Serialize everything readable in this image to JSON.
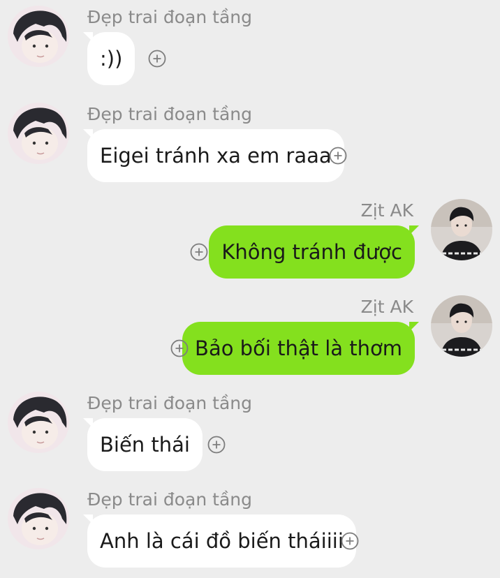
{
  "messages": [
    {
      "side": "left",
      "sender": "Đẹp trai đoạn tầng",
      "text": ":))"
    },
    {
      "side": "left",
      "sender": "Đẹp trai đoạn tầng",
      "text": "Eigei tránh xa em raaa"
    },
    {
      "side": "right",
      "sender": "Zịt AK",
      "text": "Không tránh được"
    },
    {
      "side": "right",
      "sender": "Zịt AK",
      "text": "Bảo bối thật là thơm"
    },
    {
      "side": "left",
      "sender": "Đẹp trai đoạn tầng",
      "text": "Biến thái"
    },
    {
      "side": "left",
      "sender": "Đẹp trai đoạn tầng",
      "text": "Anh là cái đồ biến tháiiii"
    }
  ],
  "colors": {
    "background": "#ededed",
    "outgoing_bubble": "#84e01e",
    "incoming_bubble": "#ffffff",
    "sender_text": "#8a8a8a"
  },
  "icons": {
    "reaction": "plus-circle-icon"
  }
}
